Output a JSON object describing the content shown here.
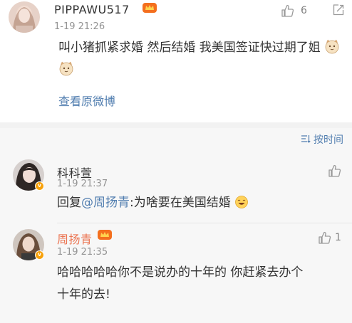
{
  "post": {
    "username": "PIPPAWU517",
    "time": "1-19 21:26",
    "likes": "6",
    "text": "叫小猪抓紧求婚 然后结婚 我美国签证快过期了姐",
    "view_original": "查看原微博"
  },
  "sort": {
    "label": "按时间"
  },
  "comments": [
    {
      "username": "科科萱",
      "time": "1-19 21:37",
      "reply_prefix": "回复",
      "mention": "@周扬青",
      "text": ":为啥要在美国结婚"
    },
    {
      "username": "周扬青",
      "time": "1-19 21:35",
      "likes": "1",
      "text": "哈哈哈哈哈你不是说办的十年的 你赶紧去办个十年的去!"
    }
  ],
  "colors": {
    "link": "#507daf",
    "highlight_name": "#eb7350",
    "badge": "#f7a10b",
    "muted": "#939393"
  },
  "icons": {
    "like": "thumbs-up-icon",
    "share": "share-icon",
    "sort": "sort-lines-icon",
    "verified": "verified-badge-icon"
  }
}
